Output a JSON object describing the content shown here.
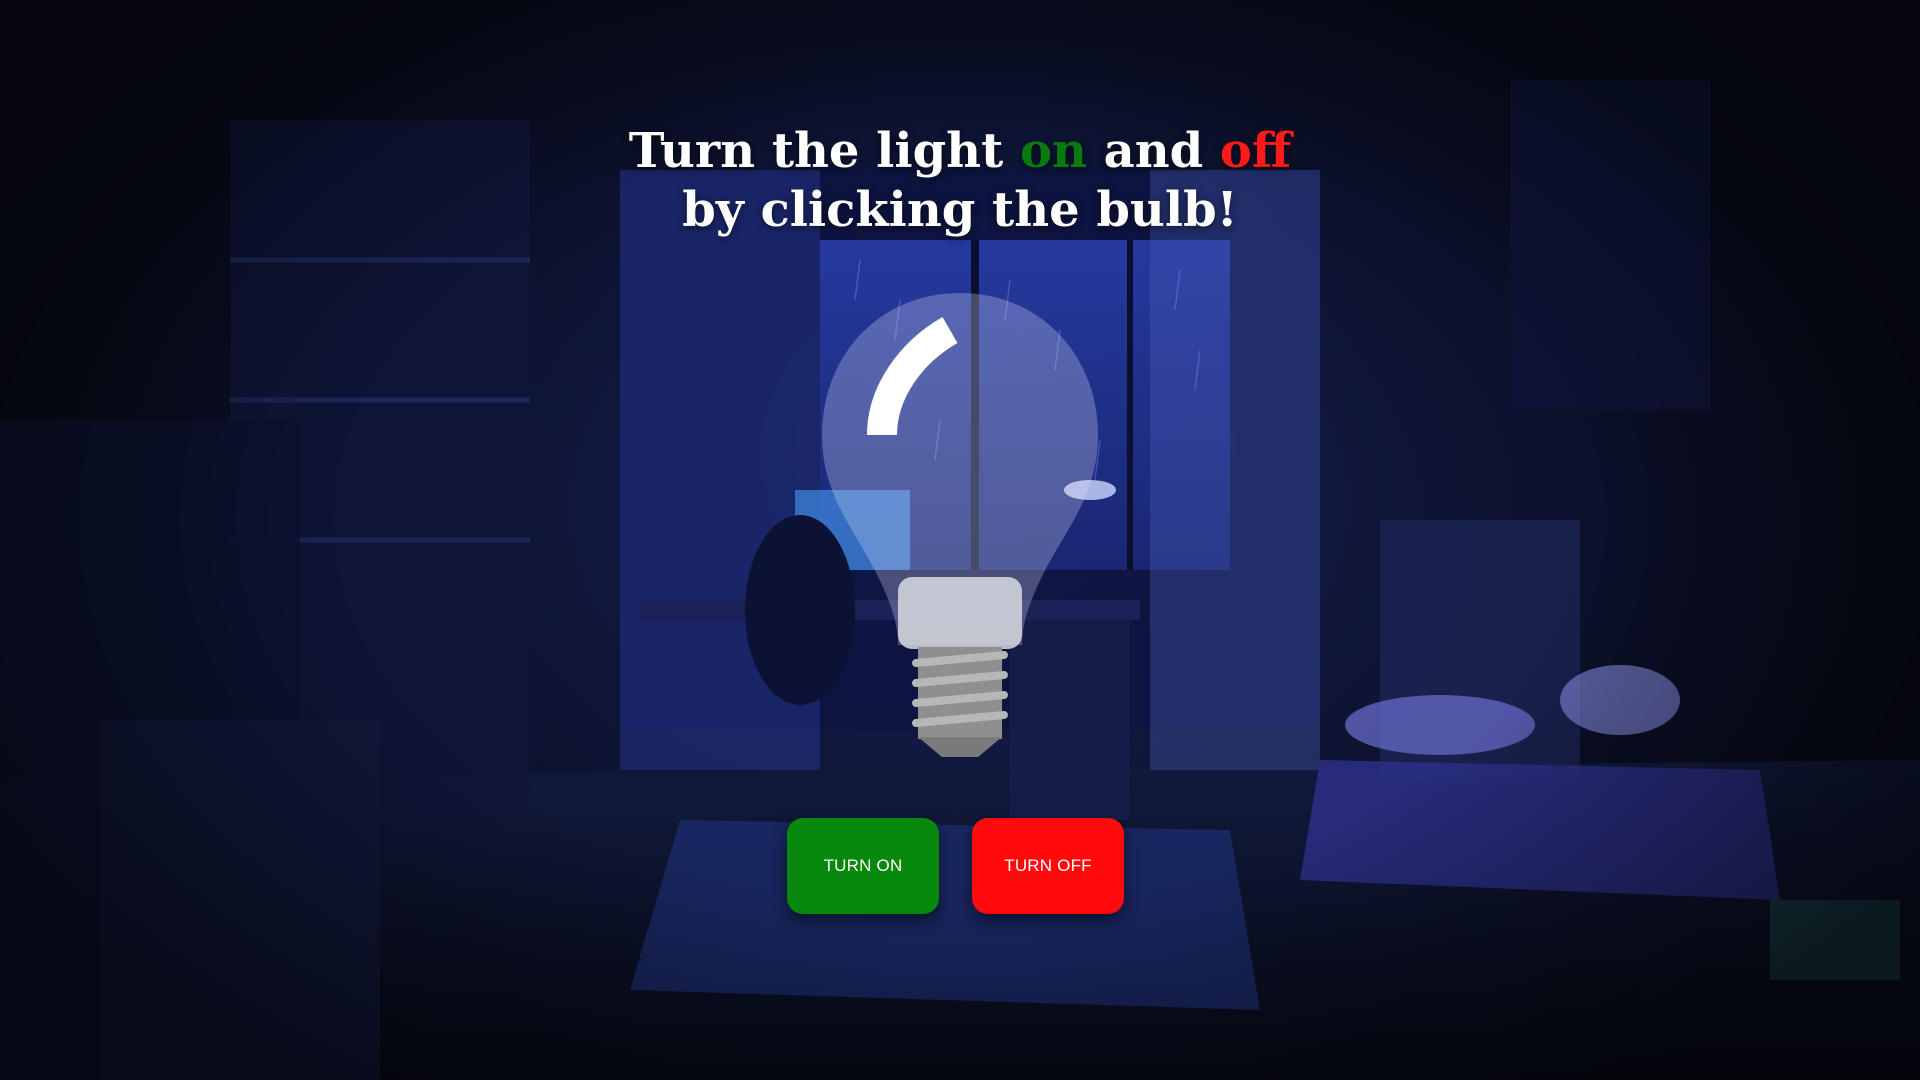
{
  "headline": {
    "line1_prefix": "Turn the light ",
    "line1_on": "on",
    "line1_mid": " and ",
    "line1_off": "off",
    "line2": "by clicking the bulb!"
  },
  "buttons": {
    "turn_on_label": "TURN ON",
    "turn_off_label": "TURN OFF"
  },
  "colors": {
    "on_accent": "#078a0b",
    "off_accent": "#ff0b0b",
    "headline_on": "#0a7a10",
    "headline_off": "#ff1a1a"
  },
  "bulb": {
    "state": "off",
    "icon": "light-bulb-icon"
  }
}
